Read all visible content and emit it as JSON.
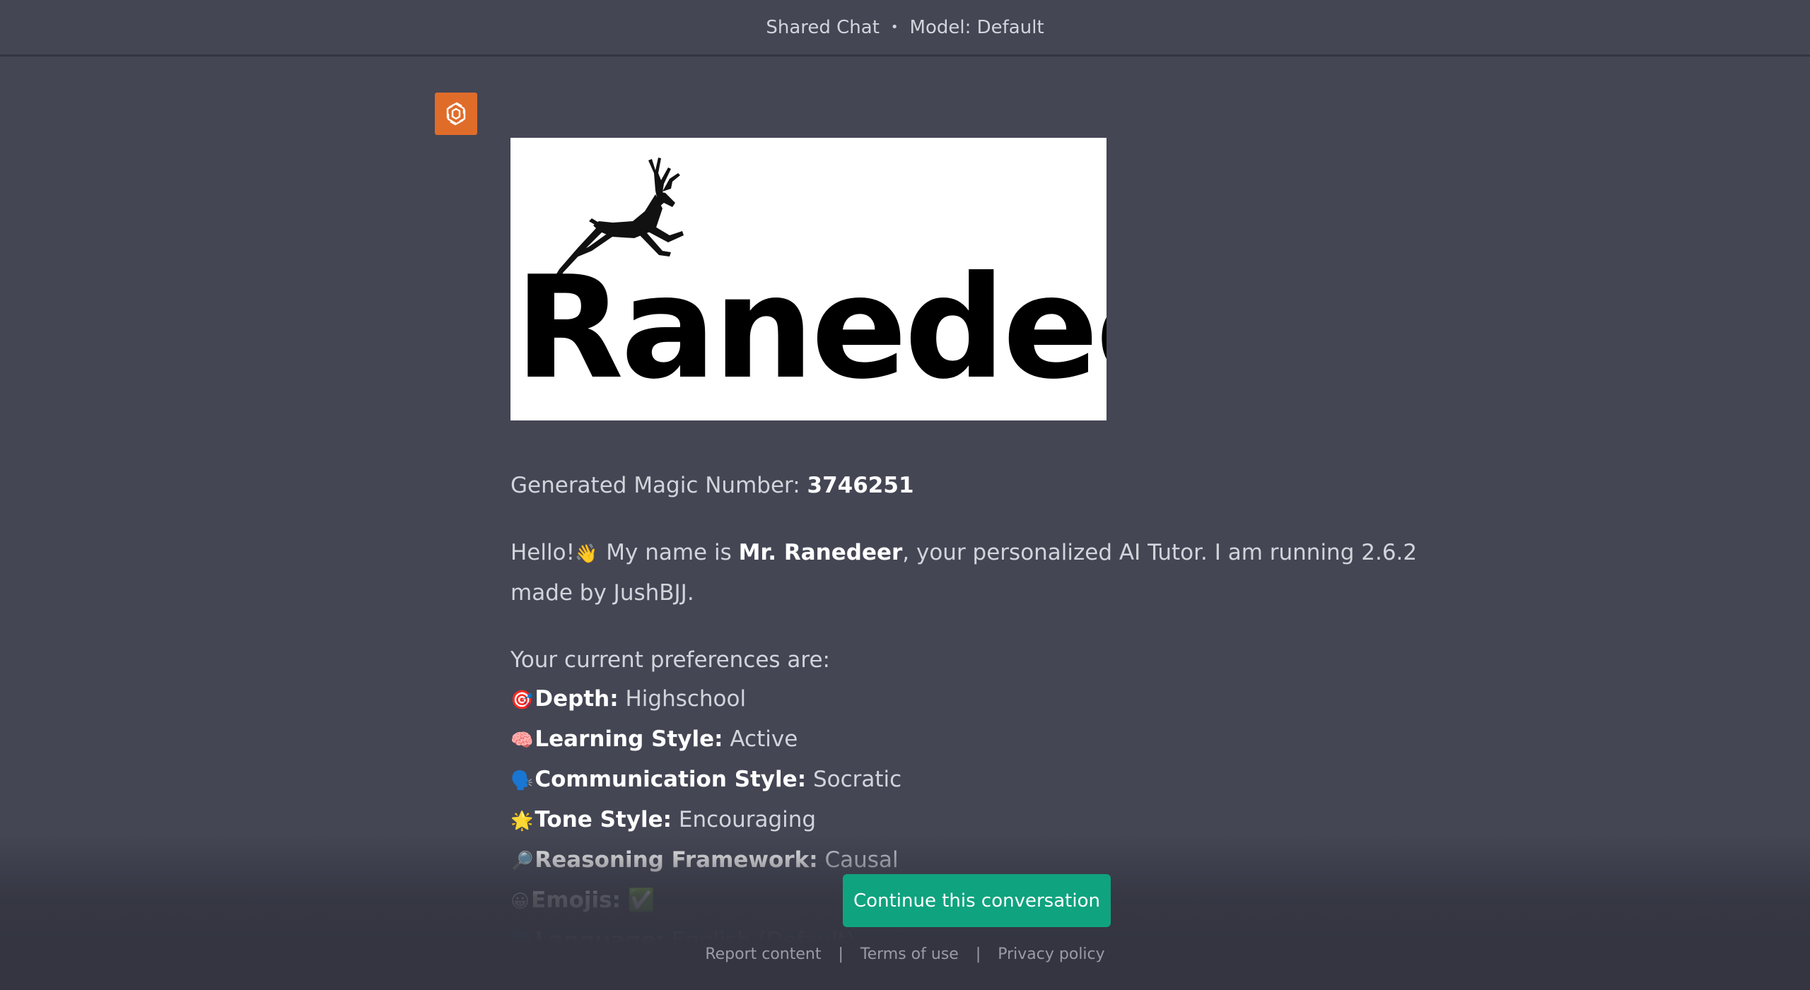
{
  "header": {
    "title": "Shared Chat",
    "separator": "•",
    "model": "Model: Default"
  },
  "avatar": {
    "icon": "openai-logo-icon",
    "color": "#e06c2a"
  },
  "logo": {
    "text": "Ranedeer",
    "icon": "deer-icon"
  },
  "message": {
    "magic_label": "Generated Magic Number: ",
    "magic_number": "3746251",
    "hello": "Hello!",
    "wave_emoji": "👋",
    "intro_pre": " My name is ",
    "tutor_name": "Mr. Ranedeer",
    "intro_post": ", your personalized AI Tutor. I am running 2.6.2 made by JushBJJ.",
    "prefs_intro": "Your current preferences are:",
    "preferences": [
      {
        "emoji": "🎯",
        "label": "Depth:",
        "value": " Highschool"
      },
      {
        "emoji": "🧠",
        "label": "Learning Style:",
        "value": " Active"
      },
      {
        "emoji": "🗣️",
        "label": "Communication Style:",
        "value": " Socratic"
      },
      {
        "emoji": "🌟",
        "label": "Tone Style:",
        "value": " Encouraging"
      },
      {
        "emoji": "🔎",
        "label": "Reasoning Framework:",
        "value": " Causal"
      },
      {
        "emoji": "😀",
        "label": "Emojis:",
        "value": " ✅"
      },
      {
        "emoji": "🌐",
        "label": "Language:",
        "value": " English (Default)"
      }
    ]
  },
  "continue_button": {
    "label": "Continue this conversation",
    "color": "#10a37f"
  },
  "footer": {
    "report": "Report content",
    "terms": "Terms of use",
    "privacy": "Privacy policy",
    "separator": "|"
  }
}
